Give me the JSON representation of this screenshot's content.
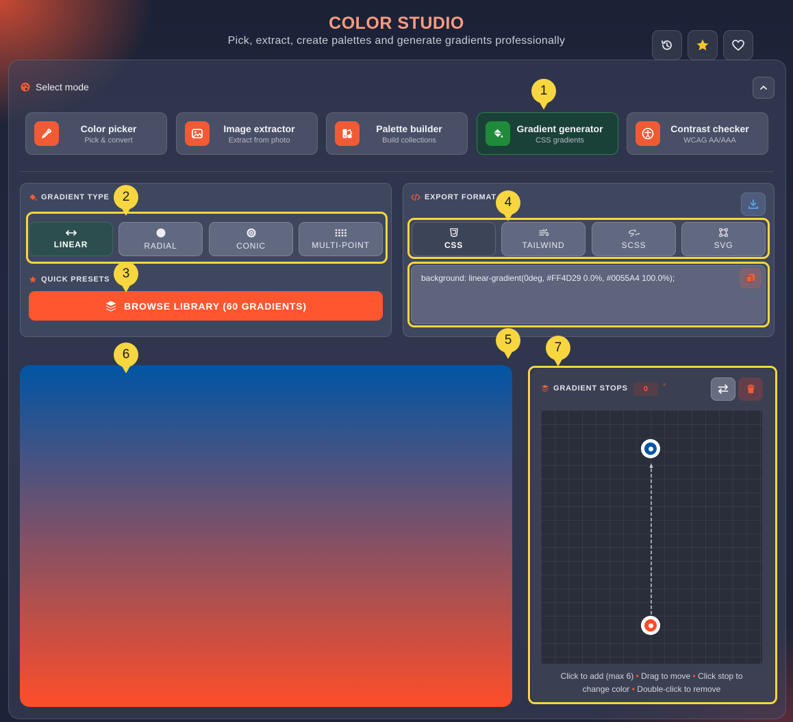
{
  "header": {
    "title": "COLOR STUDIO",
    "subtitle": "Pick, extract, create palettes and generate gradients professionally",
    "buttons": [
      {
        "icon": "history-icon"
      },
      {
        "icon": "star-icon"
      },
      {
        "icon": "heart-icon"
      }
    ]
  },
  "mode_section": {
    "label": "Select mode",
    "modes": [
      {
        "title": "Color picker",
        "subtitle": "Pick & convert",
        "icon": "eyedropper-icon",
        "active": false
      },
      {
        "title": "Image extractor",
        "subtitle": "Extract from photo",
        "icon": "image-icon",
        "active": false
      },
      {
        "title": "Palette builder",
        "subtitle": "Build collections",
        "icon": "swatchbook-icon",
        "active": false
      },
      {
        "title": "Gradient generator",
        "subtitle": "CSS gradients",
        "icon": "paint-bucket-icon",
        "active": true
      },
      {
        "title": "Contrast checker",
        "subtitle": "WCAG AA/AAA",
        "icon": "accessibility-icon",
        "active": false
      }
    ]
  },
  "gradient_type": {
    "label": "GRADIENT TYPE",
    "options": [
      {
        "label": "LINEAR",
        "icon": "arrows-horizontal-icon",
        "active": true
      },
      {
        "label": "RADIAL",
        "icon": "circle-icon",
        "active": false
      },
      {
        "label": "CONIC",
        "icon": "conic-icon",
        "active": false
      },
      {
        "label": "MULTI-POINT",
        "icon": "grid-dots-icon",
        "active": false
      }
    ]
  },
  "quick_presets": {
    "label": "QUICK PRESETS",
    "browse_label": "BROWSE LIBRARY (60 GRADIENTS)"
  },
  "export_format": {
    "label": "EXPORT FORMAT",
    "formats": [
      {
        "label": "CSS",
        "icon": "css3-icon",
        "active": true
      },
      {
        "label": "TAILWIND",
        "icon": "wind-icon",
        "active": false
      },
      {
        "label": "SCSS",
        "icon": "sass-icon",
        "active": false
      },
      {
        "label": "SVG",
        "icon": "vector-square-icon",
        "active": false
      }
    ],
    "code": "background: linear-gradient(0deg, #FF4D29 0.0%, #0055A4 100.0%);"
  },
  "gradient": {
    "angle": "0",
    "degree_symbol": "°",
    "stops": [
      {
        "color": "#FF4D29",
        "position": 0.0
      },
      {
        "color": "#0055A4",
        "position": 100.0
      }
    ]
  },
  "stops_panel": {
    "label": "GRADIENT STOPS",
    "help_1": "Click to add (max 6)",
    "help_2": "Drag to move",
    "help_3": "Click stop to",
    "help_4": "change color",
    "help_5": "Double-click to remove",
    "bullet": "•"
  },
  "annotations": [
    "1",
    "2",
    "3",
    "4",
    "5",
    "6",
    "7"
  ],
  "colors": {
    "accent": "#FF5630",
    "highlight": "#F7D640",
    "active_green": "#1F8A3A",
    "title": "#FF9B7F"
  }
}
